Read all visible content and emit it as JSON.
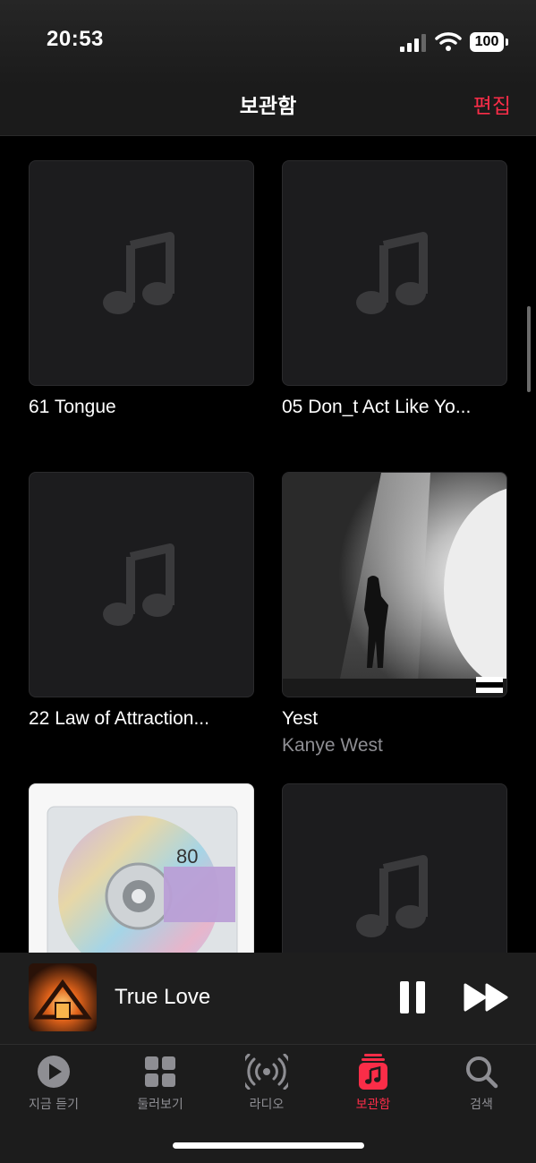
{
  "status_bar": {
    "time": "20:53",
    "battery": "100"
  },
  "nav": {
    "title": "보관함",
    "edit_label": "편집"
  },
  "albums": [
    {
      "title": "61 Tongue",
      "subtitle": ""
    },
    {
      "title": "05 Don_t Act Like Yo...",
      "subtitle": ""
    },
    {
      "title": "22 Law of Attraction...",
      "subtitle": ""
    },
    {
      "title": "Yest",
      "subtitle": "Kanye West"
    },
    {
      "title": "",
      "subtitle": ""
    },
    {
      "title": "",
      "subtitle": ""
    }
  ],
  "album_art_text": {
    "cd_number": "80"
  },
  "mini_player": {
    "title": "True Love"
  },
  "tabs": [
    {
      "label": "지금 듣기",
      "icon": "play-circle-icon"
    },
    {
      "label": "둘러보기",
      "icon": "grid-icon"
    },
    {
      "label": "라디오",
      "icon": "radio-icon"
    },
    {
      "label": "보관함",
      "icon": "library-icon",
      "active": true
    },
    {
      "label": "검색",
      "icon": "search-icon"
    }
  ],
  "colors": {
    "accent": "#fa2d48",
    "background": "#000000",
    "secondary_text": "#8e8e93"
  }
}
